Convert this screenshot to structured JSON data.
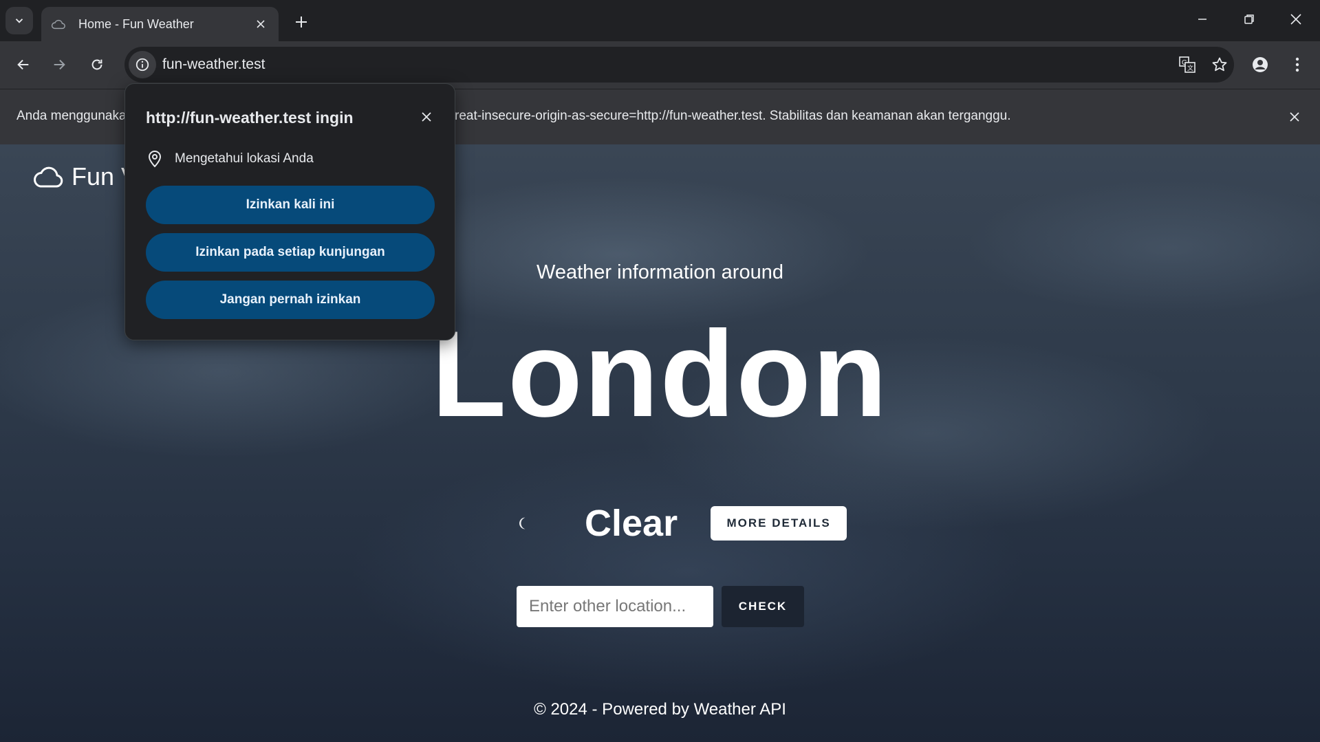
{
  "browser": {
    "tab_title": "Home - Fun Weather",
    "url": "fun-weather.test"
  },
  "infobar": {
    "text_left": "Anda menggunaka",
    "text_right": "reat-insecure-origin-as-secure=http://fun-weather.test. Stabilitas dan keamanan akan terganggu."
  },
  "popup": {
    "title": "http://fun-weather.test ingin",
    "permission": "Mengetahui lokasi Anda",
    "buttons": [
      "Izinkan kali ini",
      "Izinkan pada setiap kunjungan",
      "Jangan pernah izinkan"
    ]
  },
  "page": {
    "brand": "Fun V",
    "subtitle": "Weather information around",
    "city": "London",
    "condition": "Clear",
    "more_details": "MORE DETAILS",
    "location_placeholder": "Enter other location...",
    "check": "CHECK",
    "footer": "© 2024 - Powered by Weather API"
  },
  "colors": {
    "popup_button": "#064a7a",
    "chrome_dark": "#202124",
    "chrome_light": "#35363a",
    "moon_accent": "#3b82f6"
  }
}
